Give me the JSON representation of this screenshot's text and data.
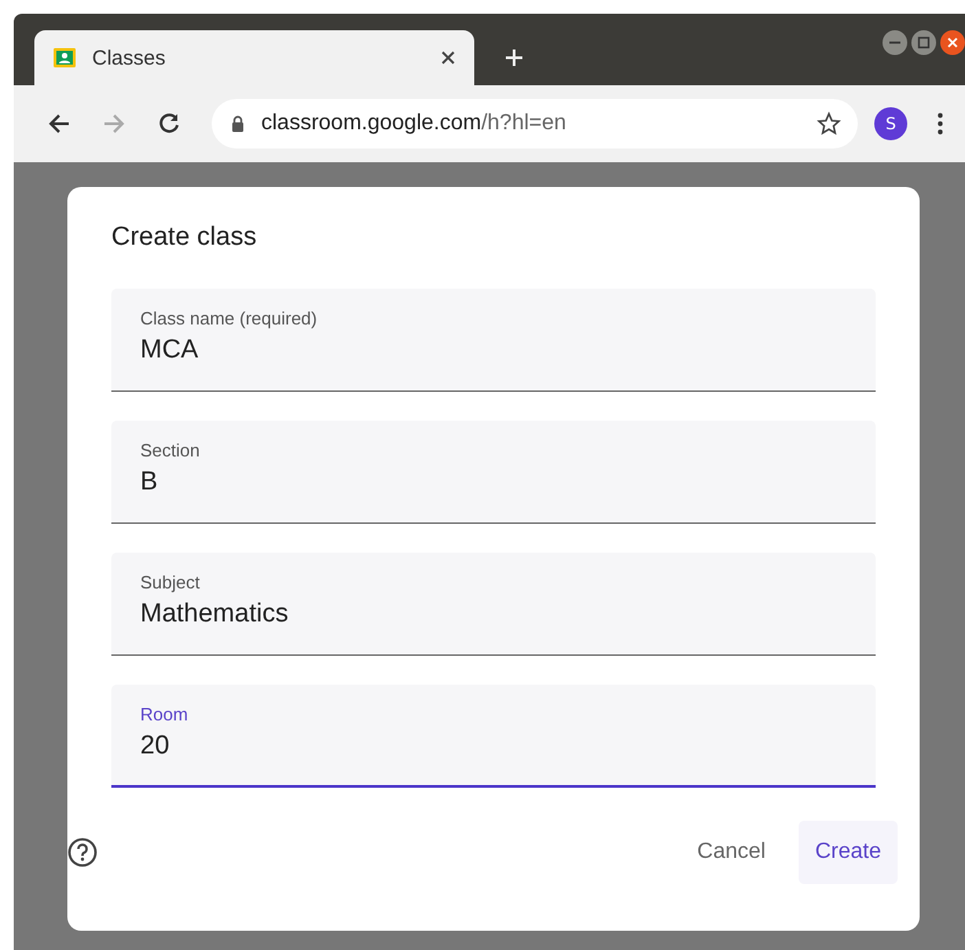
{
  "browser": {
    "tab_title": "Classes",
    "url_host": "classroom.google.com",
    "url_path": "/h?hl=en",
    "profile_initial": "S"
  },
  "dialog": {
    "title": "Create class",
    "fields": [
      {
        "label": "Class name (required)",
        "value": "MCA",
        "focused": false
      },
      {
        "label": "Section",
        "value": "B",
        "focused": false
      },
      {
        "label": "Subject",
        "value": "Mathematics",
        "focused": false
      },
      {
        "label": "Room",
        "value": "20",
        "focused": true
      }
    ],
    "buttons": [
      "Cancel",
      "Create"
    ]
  }
}
